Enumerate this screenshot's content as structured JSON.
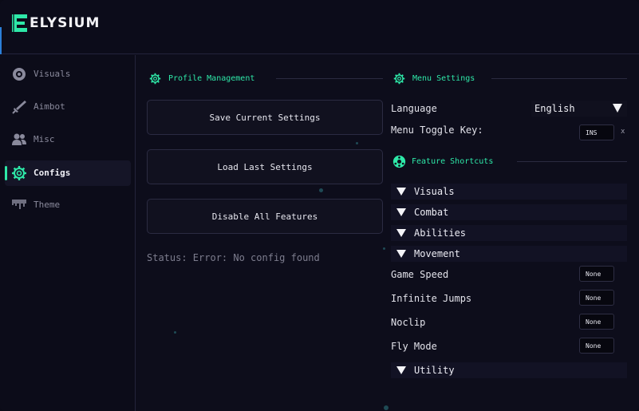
{
  "app": {
    "title": "ELYSIUM"
  },
  "sidebar": {
    "items": [
      {
        "label": "Visuals",
        "icon": "eye-circle-icon",
        "active": false
      },
      {
        "label": "Aimbot",
        "icon": "sword-icon",
        "active": false
      },
      {
        "label": "Misc",
        "icon": "users-icon",
        "active": false
      },
      {
        "label": "Configs",
        "icon": "gear-icon",
        "active": true
      },
      {
        "label": "Theme",
        "icon": "paint-drip-icon",
        "active": false
      }
    ]
  },
  "profile": {
    "header": "Profile Management",
    "buttons": {
      "save": "Save Current Settings",
      "load": "Load Last Settings",
      "disable": "Disable All Features"
    },
    "status": "Status: Error: No config found"
  },
  "menu_settings": {
    "header": "Menu Settings",
    "language_label": "Language",
    "language_value": "English",
    "toggle_label": "Menu Toggle Key:",
    "toggle_key": "INS",
    "clear": "x"
  },
  "shortcuts": {
    "header": "Feature Shortcuts",
    "sections": {
      "visuals": "Visuals",
      "combat": "Combat",
      "abilities": "Abilities",
      "movement": "Movement",
      "utility": "Utility"
    },
    "movement_items": [
      {
        "label": "Game Speed",
        "key": "None"
      },
      {
        "label": "Infinite Jumps",
        "key": "None"
      },
      {
        "label": "Noclip",
        "key": "None"
      },
      {
        "label": "Fly Mode",
        "key": "None"
      }
    ]
  },
  "colors": {
    "accent": "#2ee8a8",
    "background": "#0d0d1b",
    "panel": "#11111f"
  }
}
